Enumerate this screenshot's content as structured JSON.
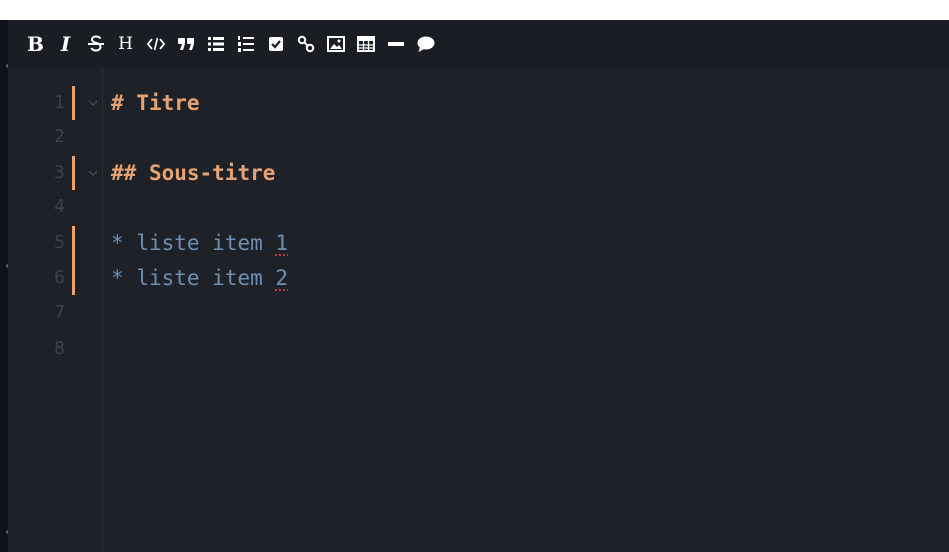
{
  "toolbar": {
    "buttons": [
      {
        "id": "bold",
        "label": "B",
        "icon": "bold-icon"
      },
      {
        "id": "italic",
        "label": "I",
        "icon": "italic-icon"
      },
      {
        "id": "strikethrough",
        "icon": "strikethrough-icon"
      },
      {
        "id": "heading",
        "label": "H",
        "icon": "heading-icon"
      },
      {
        "id": "code",
        "icon": "code-icon"
      },
      {
        "id": "quote",
        "icon": "quote-icon"
      },
      {
        "id": "unordered-list",
        "icon": "bullet-list-icon"
      },
      {
        "id": "ordered-list",
        "icon": "numbered-list-icon"
      },
      {
        "id": "task",
        "icon": "checkbox-icon"
      },
      {
        "id": "link",
        "icon": "link-icon"
      },
      {
        "id": "image",
        "icon": "image-icon"
      },
      {
        "id": "table",
        "icon": "table-icon"
      },
      {
        "id": "horizontal-rule",
        "icon": "horizontal-rule-icon"
      },
      {
        "id": "comment",
        "icon": "comment-icon"
      }
    ]
  },
  "editor": {
    "line_numbers": [
      "1",
      "2",
      "3",
      "4",
      "5",
      "6",
      "7",
      "8"
    ],
    "lines": [
      {
        "number": "1",
        "marker": "#",
        "text": "Titre",
        "kind": "heading"
      },
      {
        "number": "2",
        "text": "",
        "kind": "empty"
      },
      {
        "number": "3",
        "marker": "##",
        "text": "Sous-titre",
        "kind": "heading"
      },
      {
        "number": "4",
        "text": "",
        "kind": "empty"
      },
      {
        "number": "5",
        "marker": "*",
        "text": "liste item",
        "suffix": "1",
        "kind": "list"
      },
      {
        "number": "6",
        "marker": "*",
        "text": "liste item",
        "suffix": "2",
        "kind": "list"
      },
      {
        "number": "7",
        "text": "",
        "kind": "empty"
      },
      {
        "number": "8",
        "text": "",
        "kind": "empty"
      }
    ]
  },
  "colors": {
    "editor_background": "#1e2228",
    "toolbar_background": "#1a1e24",
    "heading": "#e8a271",
    "list": "#6d8fb3",
    "line_number": "#3c424b",
    "change_marker": "#e8a271",
    "spellcheck_underline": "#c23a3a"
  }
}
